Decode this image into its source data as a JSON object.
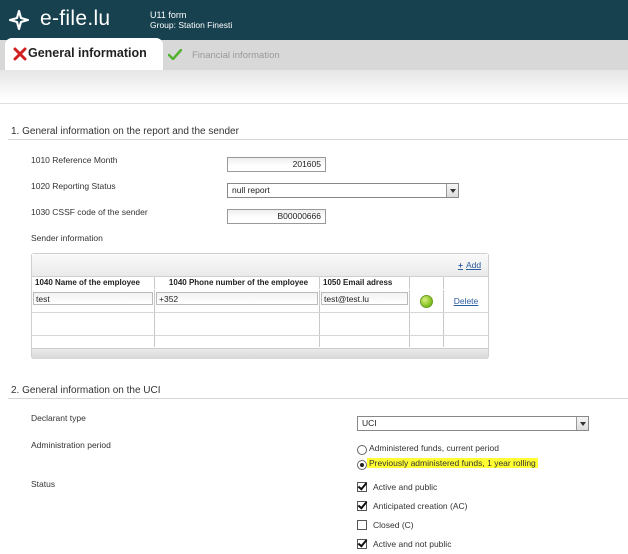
{
  "header": {
    "brand": "e-file.lu",
    "form_title": "U11 form",
    "group": "Group: Station Finesti"
  },
  "tabs": [
    {
      "label": "General information",
      "icon": "red-x-icon",
      "active": true
    },
    {
      "label": "Financial information",
      "icon": "green-check-icon",
      "active": false
    }
  ],
  "section1": {
    "title": "1. General information on the report and the sender",
    "reference_month": {
      "label": "1010 Reference Month",
      "value": "201605"
    },
    "reporting_status": {
      "label": "1020 Reporting Status",
      "value": "null report"
    },
    "cssf_code": {
      "label": "1030 CSSF code of the sender",
      "value": "B00000666"
    },
    "sender_info_label": "Sender information",
    "grid": {
      "add_label": "Add",
      "columns": [
        "1040 Name of the employee",
        "1040 Phone number of the employee",
        "1050 Email adress",
        "",
        ""
      ],
      "rows": [
        {
          "name": "test",
          "phone": "+352",
          "email": "test@test.lu",
          "status_color": "#7cbc1d",
          "action": "Delete"
        }
      ]
    }
  },
  "section2": {
    "title": "2. General information on the UCI",
    "declarant_type": {
      "label": "Declarant type",
      "value": "UCI"
    },
    "admin_period": {
      "label": "Administration period",
      "options": [
        {
          "label": "Administered funds, current period",
          "selected": false
        },
        {
          "label": "Previously administered funds, 1 year rolling",
          "selected": true
        }
      ]
    },
    "status": {
      "label": "Status",
      "options": [
        {
          "label": "Active and public",
          "checked": true
        },
        {
          "label": "Anticipated creation (AC)",
          "checked": true
        },
        {
          "label": "Closed (C)",
          "checked": false
        },
        {
          "label": "Active and not public",
          "checked": true
        }
      ]
    }
  },
  "colors": {
    "header_bg": "#17414f",
    "link": "#2a5d9f",
    "highlight": "#ffff33"
  }
}
